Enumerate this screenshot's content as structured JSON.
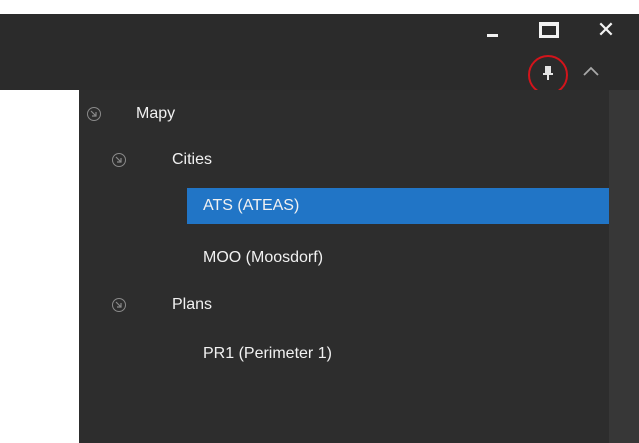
{
  "window": {
    "minimize_icon": "minimize-icon",
    "maximize_icon": "maximize-icon",
    "close_icon": "close-icon",
    "pin_icon": "pin-icon",
    "collapse_icon": "chevron-up-icon",
    "close_glyph": "✕",
    "highlight_color": "#d3141b"
  },
  "tree": {
    "root": {
      "label": "Mapy",
      "icon": "circle-arrow-icon"
    },
    "groups": [
      {
        "label": "Cities",
        "icon": "circle-arrow-icon",
        "items": [
          {
            "label": "ATS (ATEAS)",
            "selected": true
          },
          {
            "label": "MOO (Moosdorf)",
            "selected": false
          }
        ]
      },
      {
        "label": "Plans",
        "icon": "circle-arrow-icon",
        "items": [
          {
            "label": "PR1 (Perimeter 1)",
            "selected": false
          }
        ]
      }
    ]
  },
  "colors": {
    "titlebar": "#2b2b2b",
    "panel": "#2d2d2d",
    "selection": "#2175c6",
    "text": "#f1f1f1"
  }
}
